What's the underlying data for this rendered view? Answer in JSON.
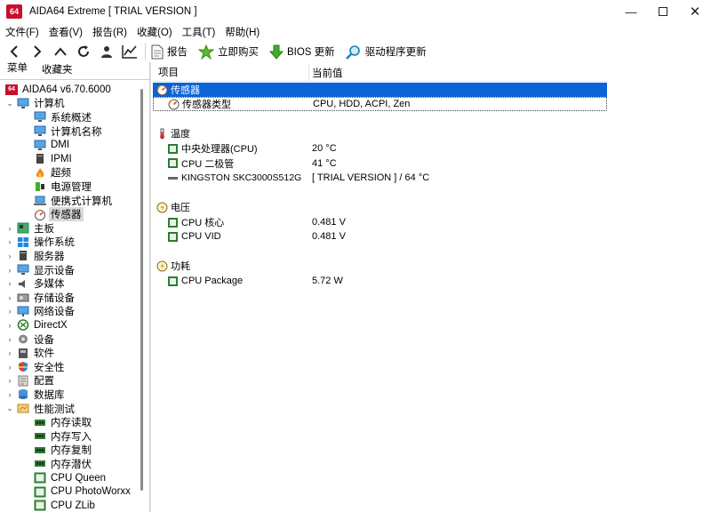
{
  "window": {
    "app_icon": "64",
    "title": "AIDA64 Extreme  [ TRIAL VERSION ]",
    "controls": [
      "minimize-icon",
      "maximize-icon",
      "close-icon"
    ]
  },
  "menu": [
    "文件(F)",
    "查看(V)",
    "报告(R)",
    "收藏(O)",
    "工具(T)",
    "帮助(H)"
  ],
  "toolbar": {
    "nav": [
      "back-icon",
      "forward-icon",
      "up-icon",
      "refresh-icon",
      "user-icon",
      "chart-icon"
    ],
    "report": "报告",
    "buy": "立即购买",
    "bios": "BIOS 更新",
    "driver": "驱动程序更新"
  },
  "panel_tabs": {
    "menu": "菜单",
    "favorites": "收藏夹"
  },
  "tree": {
    "root": "AIDA64 v6.70.6000",
    "computer": "计算机",
    "computer_children": [
      "系统概述",
      "计算机名称",
      "DMI",
      "IPMI",
      "超频",
      "电源管理",
      "便携式计算机",
      "传感器"
    ],
    "categories": [
      "主板",
      "操作系统",
      "服务器",
      "显示设备",
      "多媒体",
      "存储设备",
      "网络设备",
      "DirectX",
      "设备",
      "软件",
      "安全性",
      "配置",
      "数据库"
    ],
    "benchmark": "性能测试",
    "benchmark_children": [
      "内存读取",
      "内存写入",
      "内存复制",
      "内存潜伏",
      "CPU Queen",
      "CPU PhotoWorxx",
      "CPU ZLib"
    ]
  },
  "columns": {
    "item": "项目",
    "value": "当前值"
  },
  "sections": {
    "sensor": {
      "title": "传感器",
      "rows": [
        {
          "label": "传感器类型",
          "value": "CPU, HDD, ACPI, Zen"
        }
      ]
    },
    "temperature": {
      "title": "温度",
      "rows": [
        {
          "label": "中央处理器(CPU)",
          "value": "20 °C"
        },
        {
          "label": "CPU 二极管",
          "value": "41 °C"
        },
        {
          "label": "KINGSTON SKC3000S512G",
          "value": "[ TRIAL VERSION ] / 64 °C"
        }
      ]
    },
    "voltage": {
      "title": "电压",
      "rows": [
        {
          "label": "CPU 核心",
          "value": "0.481 V"
        },
        {
          "label": "CPU VID",
          "value": "0.481 V"
        }
      ]
    },
    "power": {
      "title": "功耗",
      "rows": [
        {
          "label": "CPU Package",
          "value": "5.72 W"
        }
      ]
    }
  },
  "colors": {
    "selection": "#0a64d8",
    "brand": "#c8102e"
  }
}
